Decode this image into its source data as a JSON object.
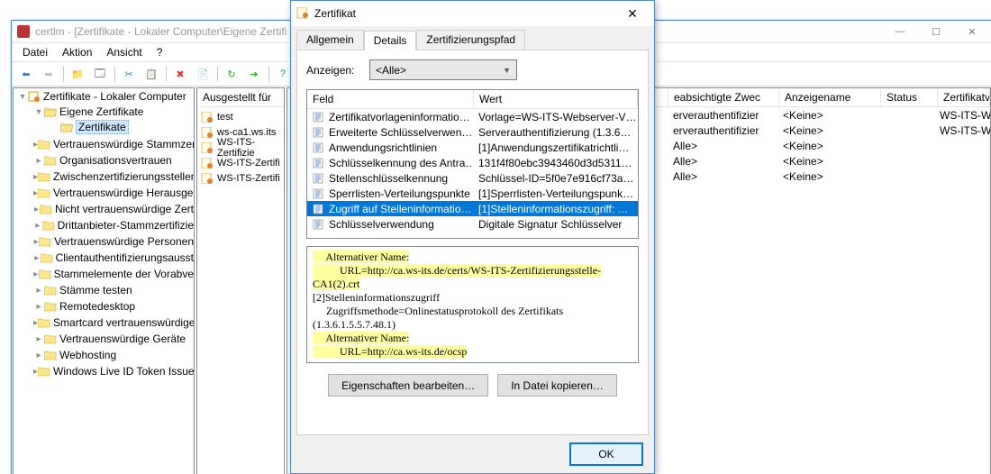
{
  "mainWindow": {
    "title": "certlm - [Zertifikate - Lokaler Computer\\Eigene Zertifi",
    "menu": {
      "file": "Datei",
      "action": "Aktion",
      "view": "Ansicht",
      "help": "?"
    }
  },
  "tree": {
    "root": "Zertifikate - Lokaler Computer",
    "own": "Eigene Zertifikate",
    "certs": "Zertifikate",
    "n": [
      "Vertrauenswürdige Stammzer",
      "Organisationsvertrauen",
      "Zwischenzertifizierungsstellen",
      "Vertrauenswürdige Herausgel",
      "Nicht vertrauenswürdige Zert",
      "Drittanbieter-Stammzertifizie",
      "Vertrauenswürdige Personen",
      "Clientauthentifizierungsausst",
      "Stammelemente der Vorabve",
      "Stämme testen",
      "Remotedesktop",
      "Smartcard vertrauenswürdige",
      "Vertrauenswürdige Geräte",
      "Webhosting",
      "Windows Live ID Token Issuer"
    ]
  },
  "mid": {
    "header": "Ausgestellt für",
    "items": [
      "test",
      "ws-ca1.ws.its",
      "WS-ITS-Zertifizie",
      "WS-ITS-Zertifi",
      "WS-ITS-Zertifi"
    ]
  },
  "right": {
    "cols": [
      "eabsichtigte Zwec",
      "Anzeigename",
      "Status",
      "Zertifikatvorlag"
    ],
    "rows": [
      [
        "erverauthentifizier",
        "<Keine>",
        "",
        "WS-ITS-Webse"
      ],
      [
        "erverauthentifizier",
        "<Keine>",
        "",
        "WS-ITS-Webse"
      ],
      [
        "Alle>",
        "<Keine>",
        "",
        ""
      ],
      [
        "Alle>",
        "<Keine>",
        "",
        ""
      ],
      [
        "Alle>",
        "<Keine>",
        "",
        ""
      ]
    ]
  },
  "dialog": {
    "title": "Zertifikat",
    "tabs": {
      "general": "Allgemein",
      "details": "Details",
      "path": "Zertifizierungspfad"
    },
    "showLabel": "Anzeigen:",
    "showValue": "<Alle>",
    "lvCols": {
      "field": "Feld",
      "value": "Wert"
    },
    "fields": [
      {
        "f": "Zertifikatvorlageninformatio…",
        "v": "Vorlage=WS-ITS-Webserver-V…"
      },
      {
        "f": "Erweiterte Schlüsselverwen…",
        "v": "Serverauthentifizierung (1.3.6…"
      },
      {
        "f": "Anwendungsrichtlinien",
        "v": "[1]Anwendungszertifikatrichtli…"
      },
      {
        "f": "Schlüsselkennung des Antra…",
        "v": "131f4f80ebc3943460d3d5311…"
      },
      {
        "f": "Stellenschlüsselkennung",
        "v": "Schlüssel-ID=5f0e7e916cf73a…"
      },
      {
        "f": "Sperrlisten-Verteilungspunkte",
        "v": "[1]Sperrlisten-Verteilungspunk…"
      },
      {
        "f": "Zugriff auf Stelleninformatio…",
        "v": "[1]Stelleninformationszugriff: …"
      },
      {
        "f": "Schlüsselverwendung",
        "v": "Digitale Signatur  Schlüsselver"
      }
    ],
    "detail": {
      "l1": "     Alternativer Name:",
      "l2": "          URL=http://ca.ws-its.de/certs/WS-ITS-Zertifizierungsstelle-",
      "l3": "CA1(2).crt",
      "l4": "[2]Stelleninformationszugriff",
      "l5": "     Zugriffsmethode=Onlinestatusprotokoll des Zertifikats",
      "l6": "(1.3.6.1.5.5.7.48.1)",
      "l7": "     Alternativer Name:",
      "l8": "          URL=http://ca.ws-its.de/ocsp"
    },
    "btnEdit": "Eigenschaften bearbeiten…",
    "btnCopy": "In Datei kopieren…",
    "ok": "OK"
  }
}
